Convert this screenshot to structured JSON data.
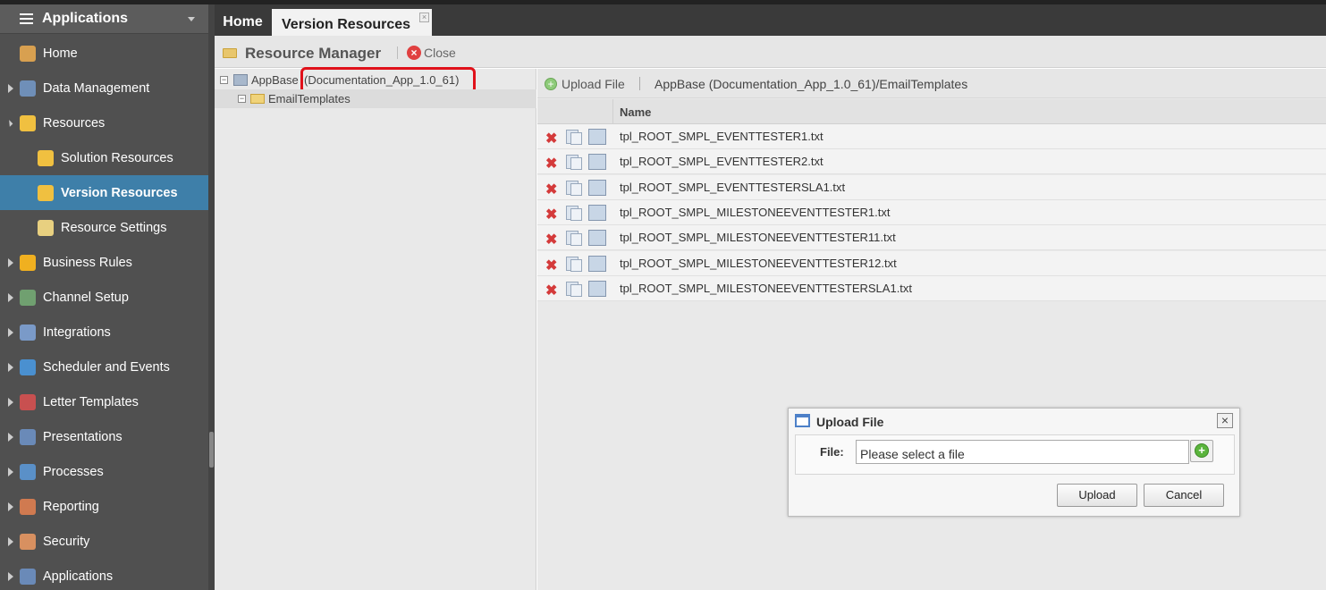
{
  "sidebar": {
    "title": "Applications",
    "items": [
      {
        "label": "Home",
        "name": "home",
        "color": "#d8a050"
      },
      {
        "label": "Data Management",
        "name": "data-management",
        "color": "#6f8fb8"
      },
      {
        "label": "Resources",
        "name": "resources",
        "color": "#f0c040"
      },
      {
        "label": "Solution Resources",
        "name": "solution-resources",
        "color": "#f0c040"
      },
      {
        "label": "Version Resources",
        "name": "version-resources",
        "color": "#f0c040"
      },
      {
        "label": "Resource Settings",
        "name": "resource-settings",
        "color": "#e8d080"
      },
      {
        "label": "Business Rules",
        "name": "business-rules",
        "color": "#f0b020"
      },
      {
        "label": "Channel Setup",
        "name": "channel-setup",
        "color": "#70a070"
      },
      {
        "label": "Integrations",
        "name": "integrations",
        "color": "#7a9ac8"
      },
      {
        "label": "Scheduler and Events",
        "name": "scheduler-and-events",
        "color": "#4a90d0"
      },
      {
        "label": "Letter Templates",
        "name": "letter-templates",
        "color": "#c85050"
      },
      {
        "label": "Presentations",
        "name": "presentations",
        "color": "#6a8ab8"
      },
      {
        "label": "Processes",
        "name": "processes",
        "color": "#5a90c8"
      },
      {
        "label": "Reporting",
        "name": "reporting",
        "color": "#d07a50"
      },
      {
        "label": "Security",
        "name": "security",
        "color": "#d89060"
      },
      {
        "label": "Applications",
        "name": "applications",
        "color": "#6a8ab8"
      }
    ]
  },
  "tabs": {
    "home": "Home",
    "version_resources": "Version Resources"
  },
  "resource_manager": {
    "title": "Resource Manager",
    "close_label": "Close"
  },
  "tree": {
    "root_label": "AppBase",
    "root_version": "(Documentation_App_1.0_61)",
    "child_label": "EmailTemplates"
  },
  "files": {
    "upload_label": "Upload File",
    "path": "AppBase (Documentation_App_1.0_61)/EmailTemplates",
    "column_name": "Name",
    "rows": [
      "tpl_ROOT_SMPL_EVENTTESTER1.txt",
      "tpl_ROOT_SMPL_EVENTTESTER2.txt",
      "tpl_ROOT_SMPL_EVENTTESTERSLA1.txt",
      "tpl_ROOT_SMPL_MILESTONEEVENTTESTER1.txt",
      "tpl_ROOT_SMPL_MILESTONEEVENTTESTER11.txt",
      "tpl_ROOT_SMPL_MILESTONEEVENTTESTER12.txt",
      "tpl_ROOT_SMPL_MILESTONEEVENTTESTERSLA1.txt"
    ]
  },
  "dialog": {
    "title": "Upload File",
    "file_label": "File:",
    "file_placeholder": "Please select a file",
    "upload_button": "Upload",
    "cancel_button": "Cancel"
  },
  "colors": {
    "sidebar_bg": "#505050",
    "active_item": "#3e7fa9",
    "highlight_box": "#e0111a"
  }
}
